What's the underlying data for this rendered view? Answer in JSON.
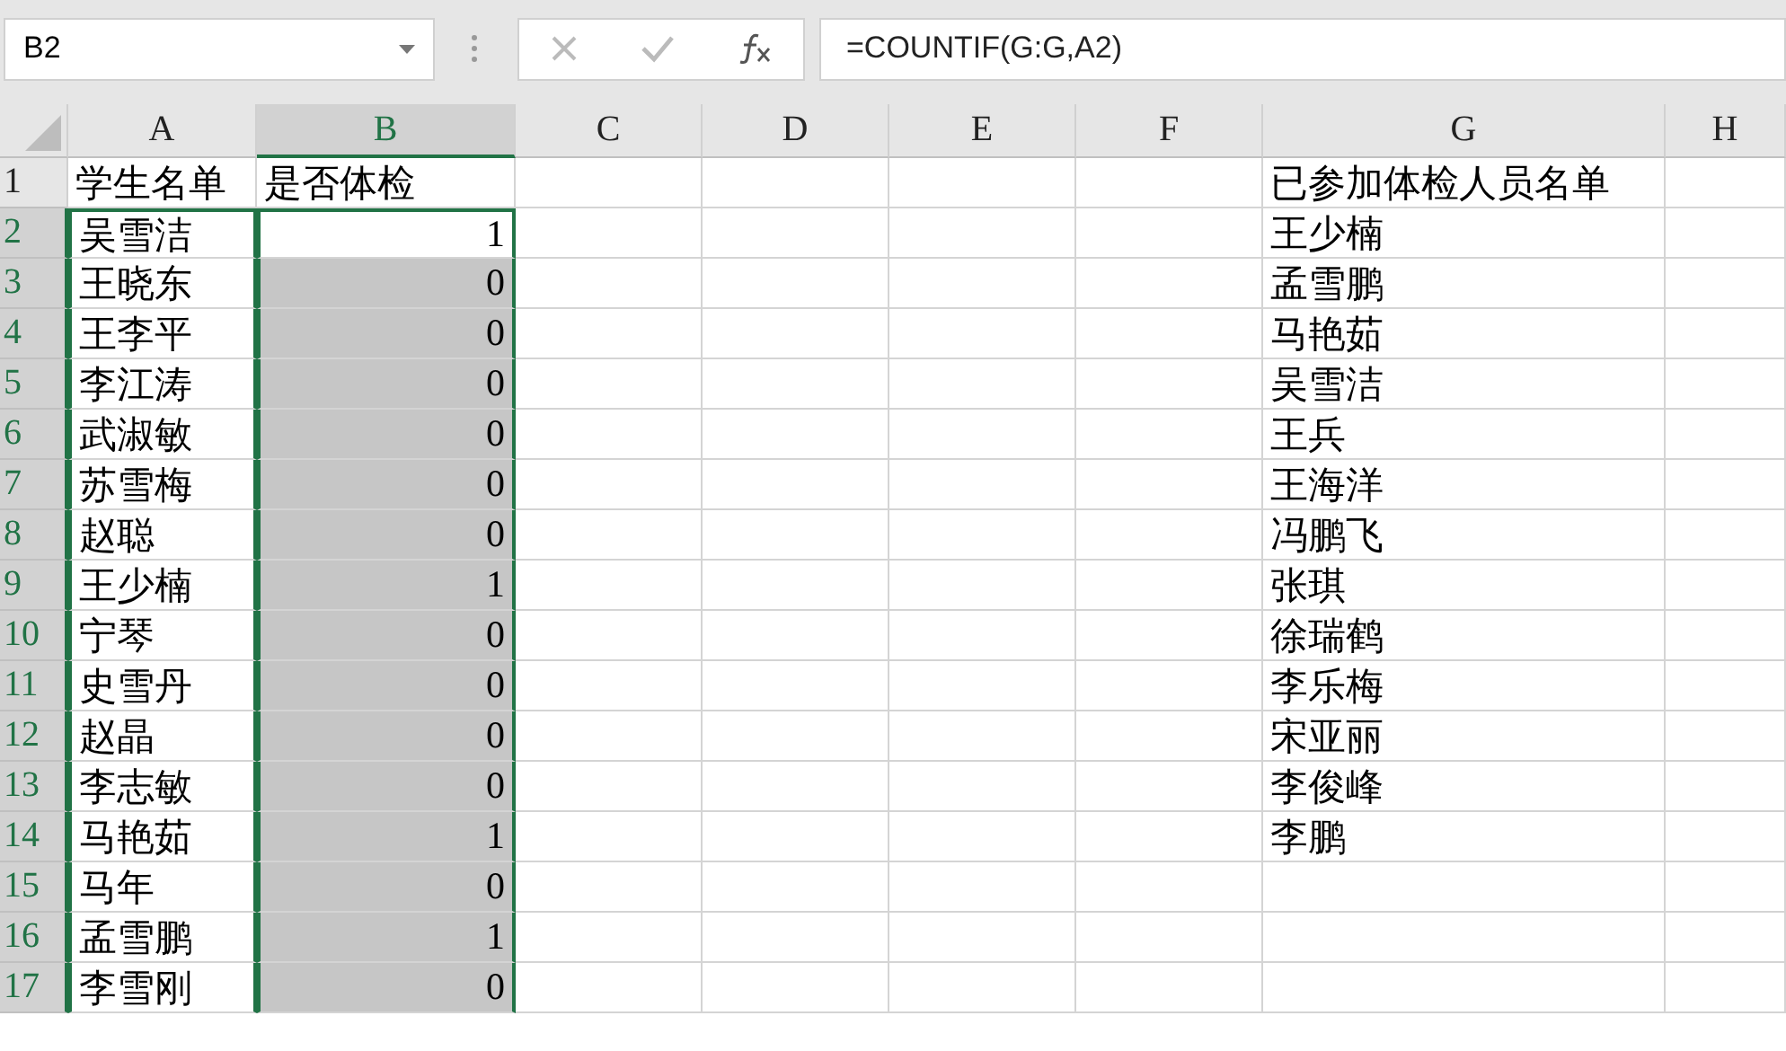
{
  "name_box": {
    "value": "B2"
  },
  "formula_bar": {
    "value": "=COUNTIF(G:G,A2)"
  },
  "columns": [
    {
      "label": "A",
      "selected": false
    },
    {
      "label": "B",
      "selected": true
    },
    {
      "label": "C",
      "selected": false
    },
    {
      "label": "D",
      "selected": false
    },
    {
      "label": "E",
      "selected": false
    },
    {
      "label": "F",
      "selected": false
    },
    {
      "label": "G",
      "selected": false
    },
    {
      "label": "H",
      "selected": false
    }
  ],
  "rows": [
    {
      "label": "1",
      "kind": "heading",
      "selected": false,
      "b_highlighted": false,
      "a": "学生名单",
      "b": "是否体检",
      "g": "已参加体检人员名单"
    },
    {
      "label": "2",
      "kind": "data",
      "selected": true,
      "b_highlighted": false,
      "a": "吴雪洁",
      "b": "1",
      "g": "王少楠"
    },
    {
      "label": "3",
      "kind": "data",
      "selected": true,
      "b_highlighted": true,
      "a": "王晓东",
      "b": "0",
      "g": "孟雪鹏"
    },
    {
      "label": "4",
      "kind": "data",
      "selected": true,
      "b_highlighted": true,
      "a": "王李平",
      "b": "0",
      "g": "马艳茹"
    },
    {
      "label": "5",
      "kind": "data",
      "selected": true,
      "b_highlighted": true,
      "a": "李江涛",
      "b": "0",
      "g": "吴雪洁"
    },
    {
      "label": "6",
      "kind": "data",
      "selected": true,
      "b_highlighted": true,
      "a": "武淑敏",
      "b": "0",
      "g": "王兵"
    },
    {
      "label": "7",
      "kind": "data",
      "selected": true,
      "b_highlighted": true,
      "a": "苏雪梅",
      "b": "0",
      "g": "王海洋"
    },
    {
      "label": "8",
      "kind": "data",
      "selected": true,
      "b_highlighted": true,
      "a": "赵聪",
      "b": "0",
      "g": "冯鹏飞"
    },
    {
      "label": "9",
      "kind": "data",
      "selected": true,
      "b_highlighted": true,
      "a": "王少楠",
      "b": "1",
      "g": "张琪"
    },
    {
      "label": "10",
      "kind": "data",
      "selected": true,
      "b_highlighted": true,
      "a": "宁琴",
      "b": "0",
      "g": "徐瑞鹤"
    },
    {
      "label": "11",
      "kind": "data",
      "selected": true,
      "b_highlighted": true,
      "a": "史雪丹",
      "b": "0",
      "g": "李乐梅"
    },
    {
      "label": "12",
      "kind": "data",
      "selected": true,
      "b_highlighted": true,
      "a": "赵晶",
      "b": "0",
      "g": "宋亚丽"
    },
    {
      "label": "13",
      "kind": "data",
      "selected": true,
      "b_highlighted": true,
      "a": "李志敏",
      "b": "0",
      "g": "李俊峰"
    },
    {
      "label": "14",
      "kind": "data",
      "selected": true,
      "b_highlighted": true,
      "a": "马艳茹",
      "b": "1",
      "g": "李鹏"
    },
    {
      "label": "15",
      "kind": "data",
      "selected": true,
      "b_highlighted": true,
      "a": "马年",
      "b": "0"
    },
    {
      "label": "16",
      "kind": "data",
      "selected": true,
      "b_highlighted": true,
      "a": "孟雪鹏",
      "b": "1"
    },
    {
      "label": "17",
      "kind": "data",
      "selected": true,
      "b_highlighted": true,
      "a": "李雪刚",
      "b": "0"
    }
  ]
}
